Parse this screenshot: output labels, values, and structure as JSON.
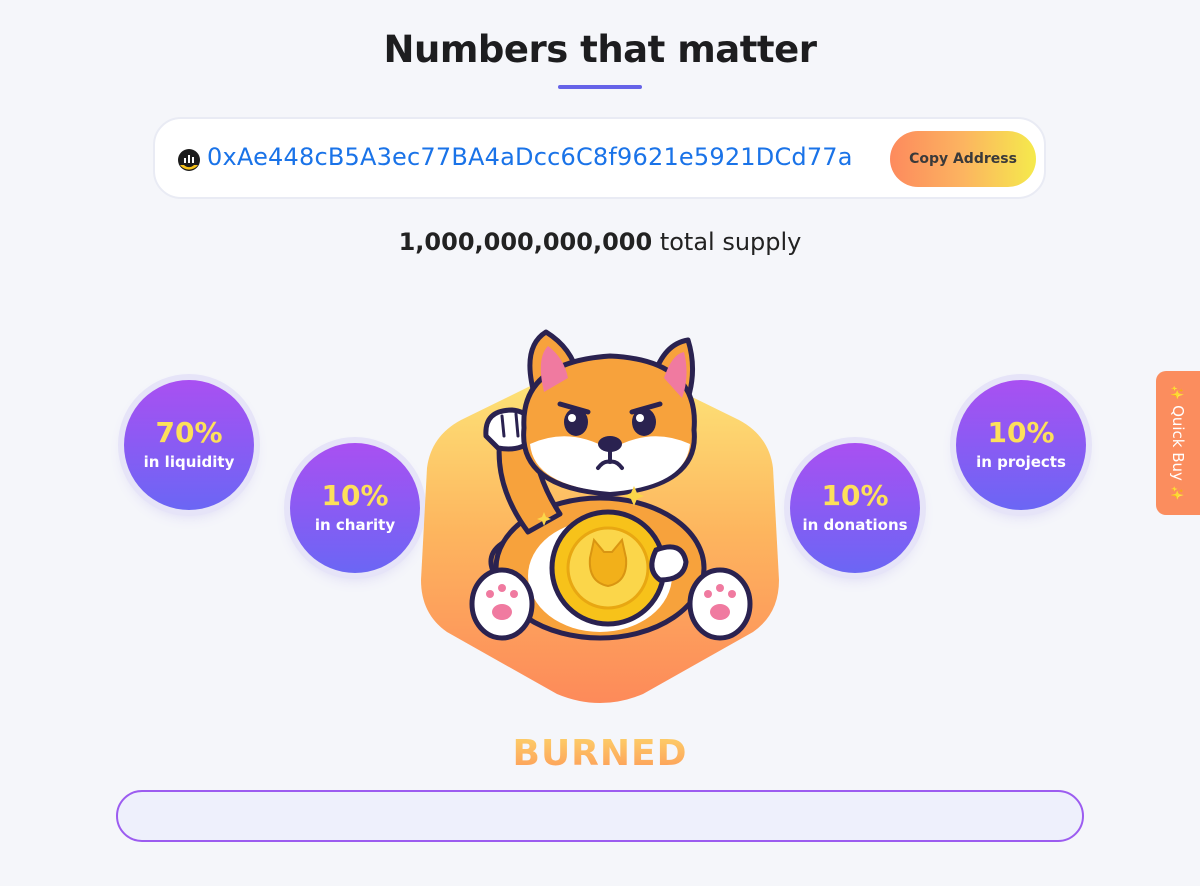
{
  "header": {
    "title": "Numbers that matter"
  },
  "contract": {
    "address": "0xAe448cB5A3ec77BA4aDcc6C8f9621e5921DCd77a",
    "copy_label": "Copy Address",
    "icon": "token-chart-icon"
  },
  "supply": {
    "amount": "1,000,000,000,000",
    "label": "total supply"
  },
  "allocations": [
    {
      "percent": "70%",
      "label": "in liquidity"
    },
    {
      "percent": "10%",
      "label": "in charity"
    },
    {
      "percent": "10%",
      "label": "in donations"
    },
    {
      "percent": "10%",
      "label": "in projects"
    }
  ],
  "burned": {
    "title": "BURNED",
    "progress": 0
  },
  "quick_buy": {
    "label": "Quick Buy",
    "icon": "sparkle-icon"
  },
  "colors": {
    "accent": "#6663e8",
    "address": "#1a73e8",
    "circle_top": "#a950f2",
    "circle_bottom": "#6b66f4",
    "percent": "#fde05a",
    "quick_buy": "#fb8d5e"
  }
}
